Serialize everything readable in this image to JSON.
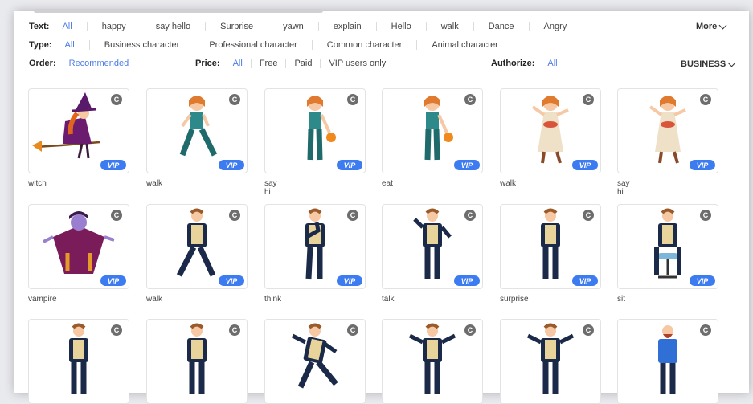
{
  "filters": {
    "text": {
      "label": "Text:",
      "options": [
        "All",
        "happy",
        "say hello",
        "Surprise",
        "yawn",
        "explain",
        "Hello",
        "walk",
        "Dance",
        "Angry"
      ],
      "more": "More"
    },
    "type": {
      "label": "Type:",
      "options": [
        "All",
        "Business character",
        "Professional character",
        "Common character",
        "Animal character"
      ]
    },
    "order": {
      "label": "Order:",
      "value": "Recommended"
    },
    "price": {
      "label": "Price:",
      "options": [
        "All",
        "Free",
        "Paid",
        "VIP users only"
      ]
    },
    "authorize": {
      "label": "Authorize:",
      "value": "All"
    },
    "category": "BUSINESS"
  },
  "badges": {
    "copyright": "C",
    "vip": "VIP"
  },
  "items": [
    {
      "caption": "witch",
      "figure": "witch"
    },
    {
      "caption": "walk",
      "figure": "girl-walk"
    },
    {
      "caption": "say hi",
      "figure": "girl-basket"
    },
    {
      "caption": "eat",
      "figure": "girl-basket"
    },
    {
      "caption": "walk",
      "figure": "girl-dress"
    },
    {
      "caption": "say hi",
      "figure": "girl-dress"
    },
    {
      "caption": "vampire",
      "figure": "vampire"
    },
    {
      "caption": "walk",
      "figure": "man-walk"
    },
    {
      "caption": "think",
      "figure": "man-think"
    },
    {
      "caption": "talk",
      "figure": "man-talk"
    },
    {
      "caption": "surprise",
      "figure": "man-stand"
    },
    {
      "caption": "sit",
      "figure": "man-sit"
    },
    {
      "caption": "",
      "figure": "man-stand"
    },
    {
      "caption": "",
      "figure": "man-stand"
    },
    {
      "caption": "",
      "figure": "man-run"
    },
    {
      "caption": "",
      "figure": "man-arms"
    },
    {
      "caption": "",
      "figure": "man-arms"
    },
    {
      "caption": "",
      "figure": "man-blue"
    }
  ]
}
